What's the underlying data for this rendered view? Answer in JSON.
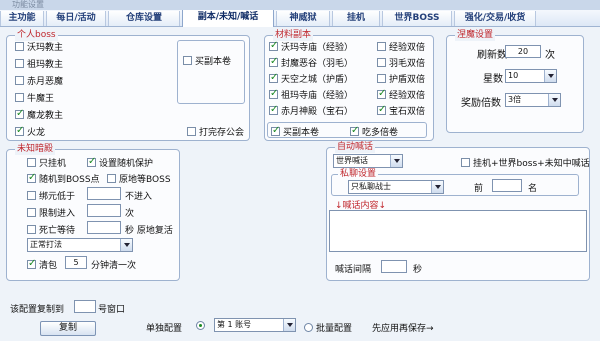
{
  "window": {
    "title": "功能设置"
  },
  "tabs": [
    "主功能",
    "每日/活动",
    "仓库设置",
    "副本/未知/喊话",
    "神威狱",
    "挂机",
    "世界BOSS",
    "强化/交易/收货"
  ],
  "personal_boss": {
    "title": "个人boss",
    "items": [
      {
        "label": "沃玛教主",
        "checked": false
      },
      {
        "label": "祖玛教主",
        "checked": false
      },
      {
        "label": "赤月恶魔",
        "checked": false
      },
      {
        "label": "牛魔王",
        "checked": false
      },
      {
        "label": "魔龙教主",
        "checked": true
      },
      {
        "label": "火龙",
        "checked": true
      }
    ],
    "buy_ticket": {
      "label": "买副本卷",
      "checked": false
    },
    "hit_warehouse": {
      "label": "打完存公会",
      "checked": false
    }
  },
  "material_dungeon": {
    "title": "材料副本",
    "items": [
      {
        "label": "沃玛寺庙（经验）",
        "checked": true,
        "double": "经验双倍",
        "double_checked": false
      },
      {
        "label": "封魔恶谷（羽毛）",
        "checked": true,
        "double": "羽毛双倍",
        "double_checked": false
      },
      {
        "label": "天空之城（护盾）",
        "checked": true,
        "double": "护盾双倍",
        "double_checked": false
      },
      {
        "label": "祖玛寺庙（经验）",
        "checked": true,
        "double": "经验双倍",
        "double_checked": true
      },
      {
        "label": "赤月神殿（宝石）",
        "checked": true,
        "double": "宝石双倍",
        "double_checked": true
      }
    ],
    "buy_ticket": {
      "label": "买副本卷",
      "checked": true
    },
    "eat_multi": {
      "label": "吃多倍卷",
      "checked": true
    }
  },
  "nirvana": {
    "title": "涅魔设置",
    "refresh_label": "刷新数",
    "refresh_value": "20",
    "refresh_unit": "次",
    "star_label": "星数",
    "star_value": "10",
    "reward_label": "奖励倍数",
    "reward_value": "3倍"
  },
  "unknown_dungeon": {
    "title": "未知暗殿",
    "only_hang": {
      "label": "只挂机",
      "checked": false
    },
    "random_protect": {
      "label": "设置随机保护",
      "checked": true
    },
    "random_boss": {
      "label": "随机到BOSS点",
      "checked": true
    },
    "stay_boss": {
      "label": "原地等BOSS",
      "checked": false
    },
    "bind_low": {
      "label": "绑元低于",
      "checked": false,
      "suffix": "不进入"
    },
    "limit_enter": {
      "label": "限制进入",
      "checked": false,
      "suffix": "次"
    },
    "death_wait": {
      "label": "死亡等待",
      "checked": false,
      "suffix": "秒 原地复活"
    },
    "fight_mode": "正常打法",
    "clear_bag": {
      "label": "清包",
      "checked": true,
      "value": "5",
      "suffix": "分钟清一次"
    }
  },
  "auto_shout": {
    "title": "自动喊话",
    "channel": "世界喊话",
    "hang_world_boss": {
      "label": "挂机+世界boss+未知中喊话",
      "checked": false
    },
    "private_title": "私聊设置",
    "private_target": "只私聊战士",
    "front_label": "前",
    "name_label": "名",
    "content_label": "↓喊话内容↓",
    "interval_label": "喊话间隔",
    "interval_unit": "秒"
  },
  "footer": {
    "copy_config_label": "该配置复制到",
    "copy_config_suffix": "号窗口",
    "copy_button": "复制",
    "single_config": "单独配置",
    "account": "第 1 账号",
    "batch_config": "批量配置",
    "hint": "先应用再保存→"
  }
}
